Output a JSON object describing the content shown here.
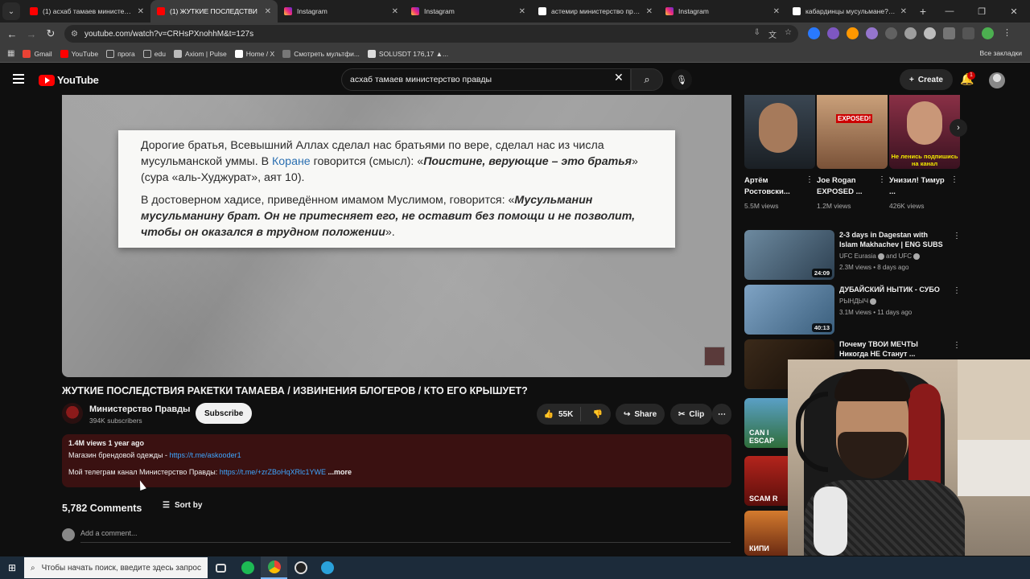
{
  "browser": {
    "tabs": [
      {
        "title": "(1) асхаб тамаев министерство",
        "favicon": "youtube",
        "active": false
      },
      {
        "title": "(1) ЖУТКИЕ ПОСЛЕДСТВИ",
        "favicon": "youtube",
        "active": true
      },
      {
        "title": "Instagram",
        "favicon": "instagram",
        "active": false
      },
      {
        "title": "Instagram",
        "favicon": "instagram",
        "active": false
      },
      {
        "title": "астемир министерство правд",
        "favicon": "google",
        "active": false
      },
      {
        "title": "Instagram",
        "favicon": "instagram",
        "active": false
      },
      {
        "title": "кабардинцы мусульмане? - П",
        "favicon": "google",
        "active": false
      }
    ],
    "url": "youtube.com/watch?v=CRHsPXnohhM&t=127s",
    "bookmarks": [
      "Gmail",
      "YouTube",
      "прога",
      "edu",
      "Axiom | Pulse",
      "Home / X",
      "Смотреть мультфи...",
      "SOLUSDT 176,17 ▲..."
    ],
    "all_bookmarks": "Все закладки"
  },
  "youtube": {
    "logo": "YouTube",
    "search_query": "асхаб тамаев министерство правды",
    "create_label": "Create",
    "notification_count": "1"
  },
  "video": {
    "paper_text": {
      "p1_a": "Дорогие братья, Всевышний Аллах сделал нас братьями по вере, сделал нас из числа мусульманской уммы. В ",
      "p1_link": "Коране",
      "p1_b": " говорится (смысл): «",
      "p1_quote": "Поистине, верующие – это братья",
      "p1_c": "» (сура «аль-Худжурат», аят 10).",
      "p2_a": "В достоверном хадисе, приведённом имамом Муслимом, говорится: «",
      "p2_quote": "Мусульманин мусульманину брат. Он не притесняет его, не оставит без помощи и не позволит, чтобы он оказался в трудном положении",
      "p2_b": "»."
    },
    "title": "ЖУТКИЕ ПОСЛЕДСТВИЯ РАКЕТКИ ТАМАЕВА / ИЗВИНЕНИЯ БЛОГЕРОВ / КТО ЕГО КРЫШУЕТ?",
    "channel": "Министерство Правды",
    "subscribers": "394K subscribers",
    "subscribe_label": "Subscribe",
    "likes": "55K",
    "share_label": "Share",
    "clip_label": "Clip",
    "description": {
      "meta": "1.4M views  1 year ago",
      "line1_text": "Магазин брендовой одежды - ",
      "line1_link": "https://t.me/askooder1",
      "line2_text": "Мой телеграм канал Министерство Правды: ",
      "line2_link": "https://t.me/+zrZBoHqXRlc1YWE",
      "more": "...more"
    },
    "comments_count": "5,782 Comments",
    "sort_label": "Sort by",
    "add_comment": "Add a comment..."
  },
  "shorts": [
    {
      "title": "Артём Ростовски...",
      "views": "5.5M views"
    },
    {
      "title": "Joe Rogan EXPOSED ...",
      "views": "1.2M views",
      "badge": "EXPOSED!"
    },
    {
      "title": "Унизил! Тимур ...",
      "views": "426K views",
      "overlay": "Не ленись подпишись на канал"
    }
  ],
  "recommendations": [
    {
      "title": "2-3 days in Dagestan with Islam Makhachev | ENG SUBS",
      "channel": "UFC Eurasia",
      "channel2": "and UFC",
      "meta": "2.3M views • 8 days ago",
      "duration": "24:09"
    },
    {
      "title": "ДУБАЙСКИЙ НЫТИК - СУБО",
      "channel": "РЫНДЫЧ",
      "meta": "3.1M views • 11 days ago",
      "duration": "40:13"
    },
    {
      "title": "Почему ТВОИ МЕЧТЫ Никогда НЕ Станут ...",
      "channel": "",
      "meta": "",
      "duration": ""
    }
  ],
  "side_captions": [
    "CAN I ESCAP",
    "SCAM R",
    "КИПИ"
  ],
  "taskbar": {
    "search_placeholder": "Чтобы начать поиск, введите здесь запрос"
  }
}
